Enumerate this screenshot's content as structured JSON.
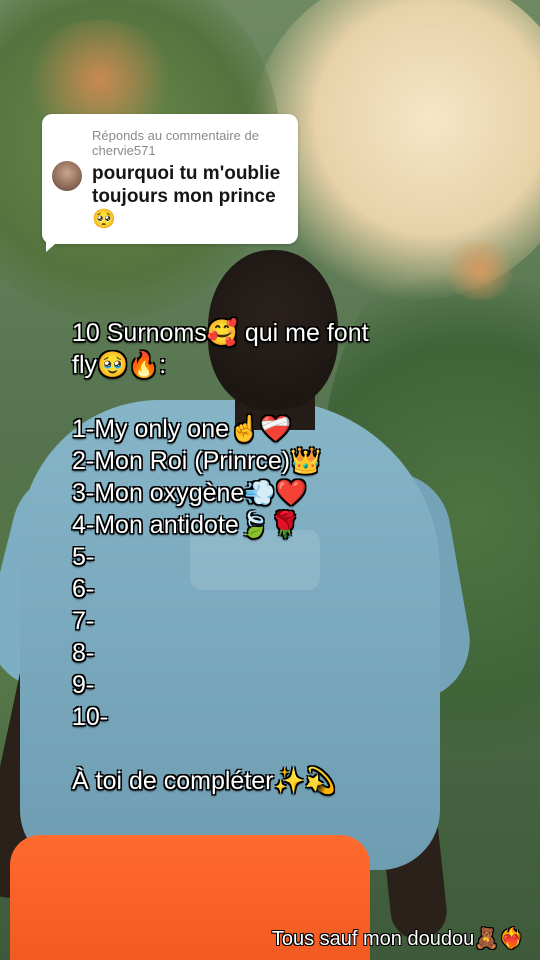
{
  "comment": {
    "reply_line": "Réponds au commentaire de chervie571",
    "text": "pourquoi tu m'oublie toujours mon prince 🥺"
  },
  "overlay": {
    "title_line1": "10 Surnoms🥰 qui me font",
    "title_line2": "fly🥹🔥:",
    "items": [
      "1-My only one☝️❤️‍🩹",
      "2-Mon Roi (Prinrce)👑",
      "3-Mon oxygène💨❤️",
      "4-Mon antidote🍃🌹",
      "5-",
      "6-",
      "7-",
      "8-",
      "9-",
      "10-"
    ],
    "closing": "À toi de compléter✨💫"
  },
  "caption": "Tous sauf mon doudou🧸❤️‍🔥"
}
